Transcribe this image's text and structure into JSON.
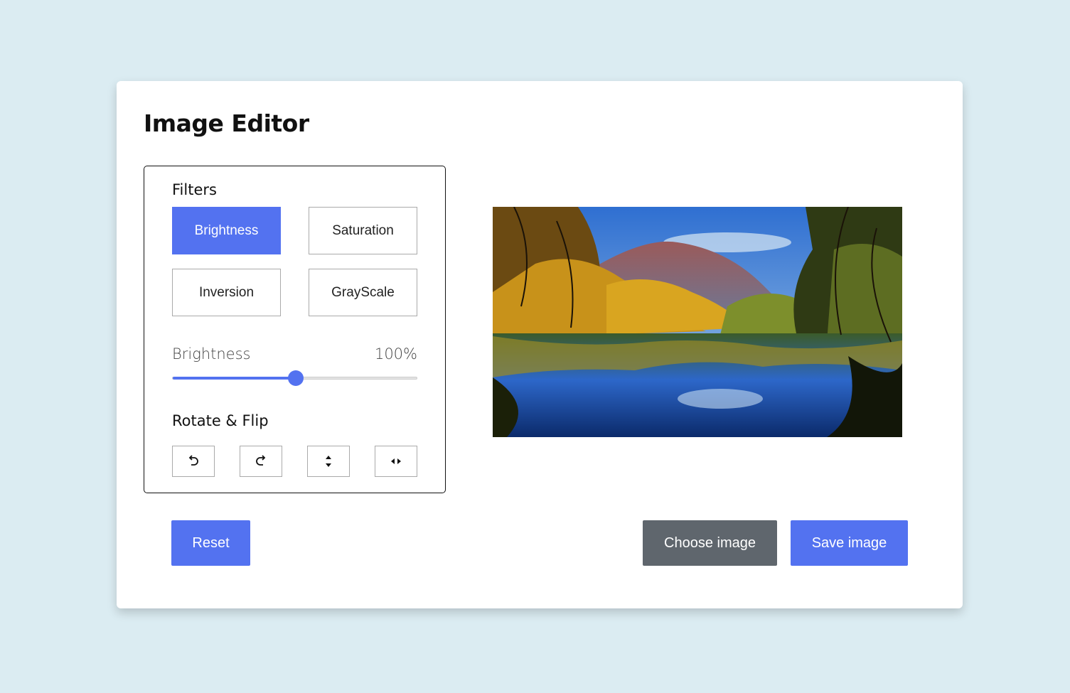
{
  "app": {
    "title": "Image Editor"
  },
  "filters": {
    "label": "Filters",
    "options": [
      "Brightness",
      "Saturation",
      "Inversion",
      "GrayScale"
    ],
    "active": "Brightness"
  },
  "slider": {
    "name": "Brightness",
    "value_text": "100%",
    "fraction": 0.5
  },
  "rotate_flip": {
    "label": "Rotate & Flip",
    "icons": [
      "rotate-left-icon",
      "rotate-right-icon",
      "flip-vertical-icon",
      "flip-horizontal-icon"
    ]
  },
  "actions": {
    "reset": "Reset",
    "choose": "Choose image",
    "save": "Save image"
  },
  "colors": {
    "accent": "#5372f0",
    "secondary": "#5f666d",
    "background": "#dbecf2"
  }
}
